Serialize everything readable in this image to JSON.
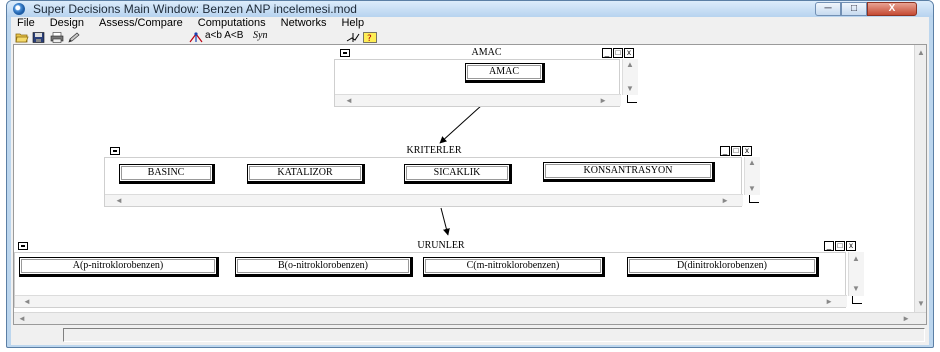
{
  "window": {
    "title": "Super Decisions Main Window: Benzen ANP incelemesi.mod",
    "buttons": [
      "─",
      "□",
      "X"
    ]
  },
  "menu": [
    "File",
    "Design",
    "Assess/Compare",
    "Computations",
    "Networks",
    "Help"
  ],
  "toolbar": {
    "icons": [
      "open-folder-icon",
      "save-disk-icon",
      "print-icon",
      "edit-pencil-icon",
      "node-connect-icon",
      "sensitivity-icon",
      "help-question-icon"
    ],
    "compare_text": "a<b A<B",
    "syn_text": "Syn"
  },
  "clusters": {
    "amac": {
      "title": "AMAC",
      "nodes": [
        "AMAC"
      ]
    },
    "kriterler": {
      "title": "KRITERLER",
      "nodes": [
        "BASINC",
        "KATALIZOR",
        "SICAKLIK",
        "KONSANTRASYON"
      ]
    },
    "urunler": {
      "title": "URUNLER",
      "nodes": [
        "A(p-nitroklorobenzen)",
        "B(o-nitroklorobenzen)",
        "C(m-nitroklorobenzen)",
        "D(dinitroklorobenzen)"
      ]
    }
  },
  "cluster_controls": [
    "_",
    "□",
    "x"
  ],
  "colors": {
    "titlebar": "#bcd6ee",
    "close_button": "#c54a33",
    "canvas": "#ffffff"
  }
}
